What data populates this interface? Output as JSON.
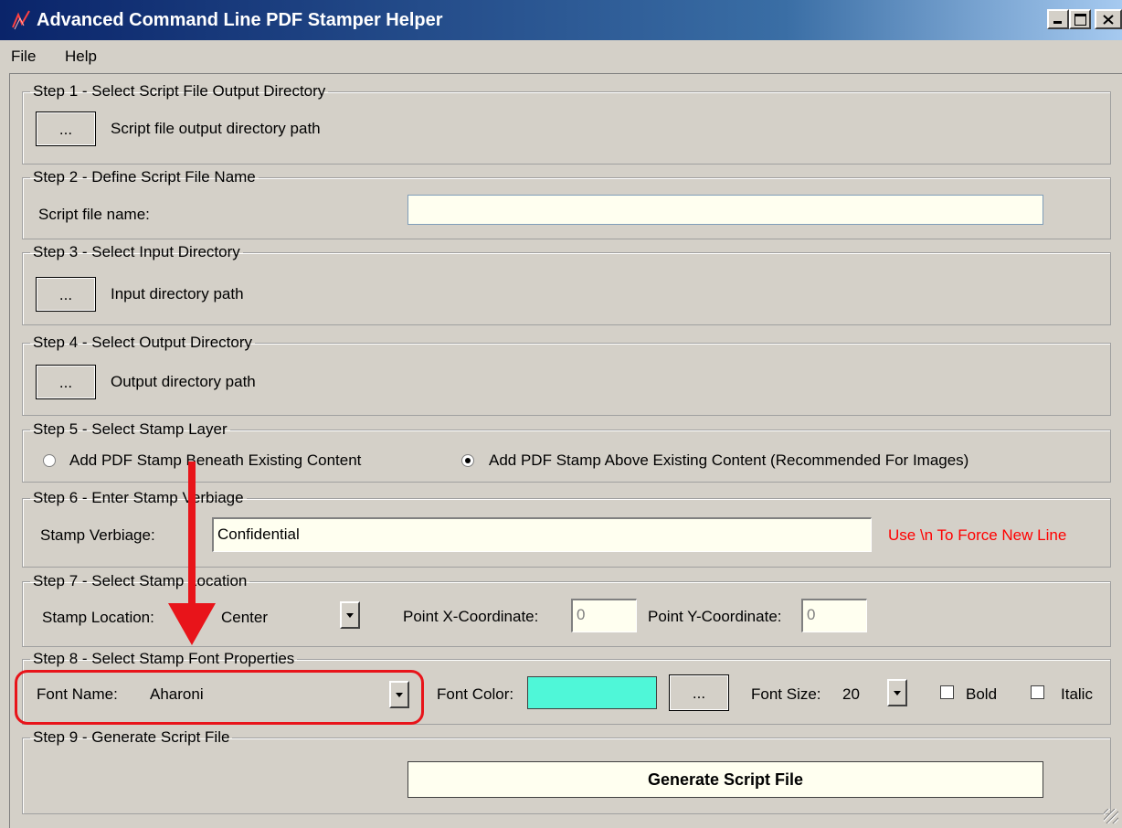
{
  "window": {
    "title": "Advanced Command Line PDF Stamper Helper"
  },
  "menu": {
    "file": "File",
    "help": "Help"
  },
  "step1": {
    "legend": "Step 1 - Select Script File Output Directory",
    "browse": "...",
    "path": "Script file output directory path"
  },
  "step2": {
    "legend": "Step 2 - Define Script File Name",
    "label": "Script file name:",
    "value": ""
  },
  "step3": {
    "legend": "Step 3 - Select Input Directory",
    "browse": "...",
    "path": "Input directory path"
  },
  "step4": {
    "legend": "Step 4 - Select Output Directory",
    "browse": "...",
    "path": "Output directory path"
  },
  "step5": {
    "legend": "Step 5 - Select Stamp Layer",
    "option_beneath": "Add PDF Stamp Beneath Existing Content",
    "option_above": "Add PDF Stamp Above Existing Content (Recommended For Images)",
    "selected": "above"
  },
  "step6": {
    "legend": "Step 6 - Enter Stamp Verbiage",
    "label": "Stamp Verbiage:",
    "value": "Confidential",
    "hint": "Use \\n To Force New Line",
    "hint_color": "#ff0000"
  },
  "step7": {
    "legend": "Step 7 - Select Stamp Location",
    "label": "Stamp Location:",
    "location": "Center",
    "x_label": "Point X-Coordinate:",
    "x_value": "0",
    "y_label": "Point Y-Coordinate:",
    "y_value": "0"
  },
  "step8": {
    "legend": "Step 8 - Select Stamp Font Properties",
    "font_label": "Font Name:",
    "font_value": "Aharoni",
    "color_label": "Font Color:",
    "color_value": "#4ff7d8",
    "color_browse": "...",
    "size_label": "Font Size:",
    "size_value": "20",
    "bold": "Bold",
    "italic": "Italic",
    "bold_checked": false,
    "italic_checked": false
  },
  "step9": {
    "legend": "Step 9 - Generate Script File",
    "generate": "Generate Script File"
  },
  "annotation": {
    "color": "#e8141a"
  }
}
